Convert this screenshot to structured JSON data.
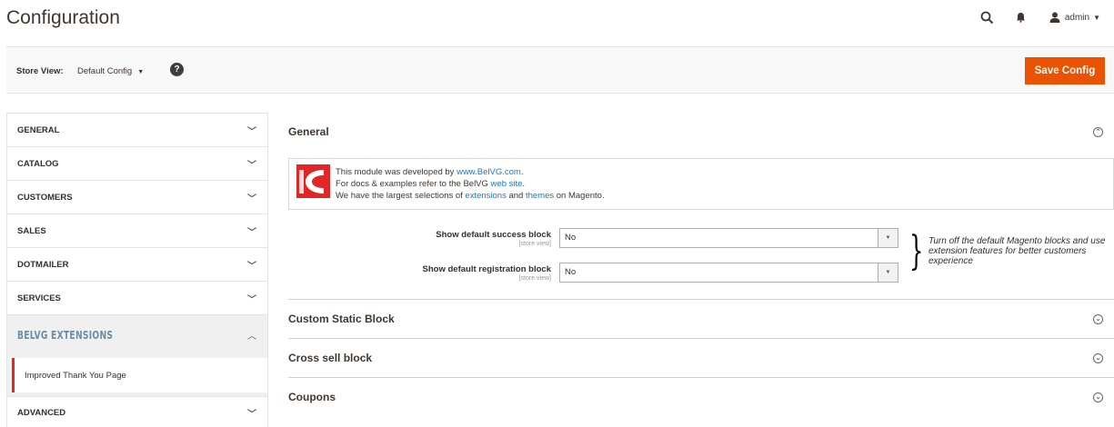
{
  "header": {
    "title": "Configuration",
    "admin_label": "admin"
  },
  "store_bar": {
    "label": "Store View:",
    "selected": "Default Config",
    "help": "?",
    "save_label": "Save Config"
  },
  "sidebar": {
    "items": [
      {
        "label": "GENERAL"
      },
      {
        "label": "CATALOG"
      },
      {
        "label": "CUSTOMERS"
      },
      {
        "label": "SALES"
      },
      {
        "label": "DOTMAILER"
      },
      {
        "label": "SERVICES"
      }
    ],
    "belvg": {
      "label": "BELVG EXTENSIONS",
      "sub_item": "Improved Thank You Page"
    },
    "advanced": {
      "label": "ADVANCED"
    }
  },
  "main": {
    "general": {
      "title": "General",
      "info": {
        "line1_prefix": "This module was developed by ",
        "line1_link": "www.BelVG.com",
        "line1_suffix": ".",
        "line2_prefix": "For docs & examples refer to the BelVG ",
        "line2_link": "web site",
        "line2_suffix": ".",
        "line3_prefix": "We have the largest selections of ",
        "line3_link1": "extensions",
        "line3_mid": " and ",
        "line3_link2": "themes",
        "line3_suffix": " on Magento."
      },
      "fields": [
        {
          "label": "Show default success block",
          "scope": "[store view]",
          "value": "No"
        },
        {
          "label": "Show default registration block",
          "scope": "[store view]",
          "value": "No"
        }
      ],
      "note": "Turn off the default Magento blocks and use extension features for better customers experience"
    },
    "sections": [
      {
        "title": "Custom Static Block"
      },
      {
        "title": "Cross sell block"
      },
      {
        "title": "Coupons"
      }
    ]
  },
  "colors": {
    "accent": "#eb5202",
    "link": "#1979c3",
    "active_marker": "#e22626"
  }
}
